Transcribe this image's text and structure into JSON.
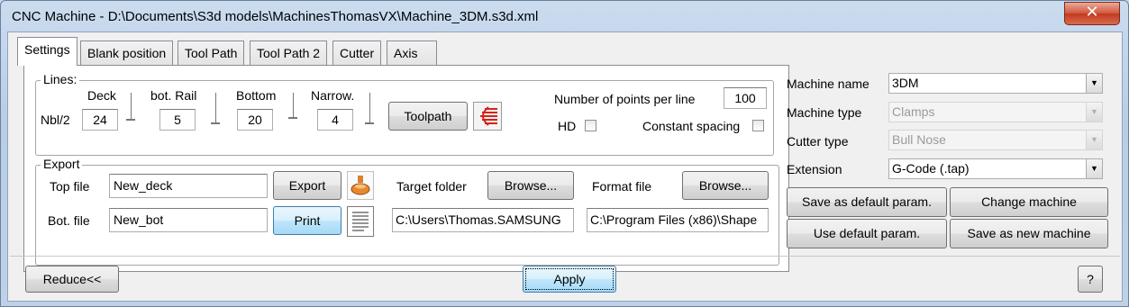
{
  "window": {
    "title": "CNC Machine - D:\\Documents\\S3d models\\MachinesThomasVX\\Machine_3DM.s3d.xml",
    "close_glyph": "✕"
  },
  "tabs": [
    {
      "label": "Settings",
      "active": true
    },
    {
      "label": "Blank position"
    },
    {
      "label": "Tool Path"
    },
    {
      "label": "Tool Path 2"
    },
    {
      "label": "Cutter"
    },
    {
      "label": "Axis"
    }
  ],
  "lines": {
    "legend": "Lines:",
    "nbl_label": "Nbl/2",
    "deck_label": "Deck",
    "bot_rail_label": "bot. Rail",
    "bottom_label": "Bottom",
    "narrow_label": "Narrow.",
    "deck_value": "24",
    "bot_rail_value": "5",
    "bottom_value": "20",
    "narrow_value": "4",
    "toolpath_button": "Toolpath",
    "toolpath_icon": "toolpath-lines-icon",
    "points_label": "Number of points per line",
    "points_value": "100",
    "hd_label": "HD",
    "hd_checked": false,
    "constant_spacing_label": "Constant spacing",
    "constant_spacing_checked": false
  },
  "export": {
    "legend": "Export",
    "top_file_label": "Top file",
    "top_file_value": "New_deck",
    "bot_file_label": "Bot. file",
    "bot_file_value": "New_bot",
    "export_button": "Export",
    "print_button": "Print",
    "target_folder_label": "Target folder",
    "target_browse": "Browse...",
    "target_path": "C:\\Users\\Thomas.SAMSUNG",
    "format_file_label": "Format file",
    "format_browse": "Browse...",
    "format_path": "C:\\Program Files (x86)\\Shape"
  },
  "machine": {
    "name_label": "Machine name",
    "name_value": "3DM",
    "type_label": "Machine type",
    "type_value": "Clamps",
    "cutter_label": "Cutter type",
    "cutter_value": "Bull Nose",
    "extension_label": "Extension",
    "extension_value": "G-Code (.tap)",
    "save_default": "Save as default param.",
    "change_machine": "Change machine",
    "use_default": "Use default param.",
    "save_new": "Save as new machine"
  },
  "footer": {
    "reduce_button": "Reduce<<",
    "apply_button": "Apply",
    "help_button": "?"
  },
  "colors": {
    "accent": "#3c7fb1",
    "close": "#c23a1f"
  }
}
